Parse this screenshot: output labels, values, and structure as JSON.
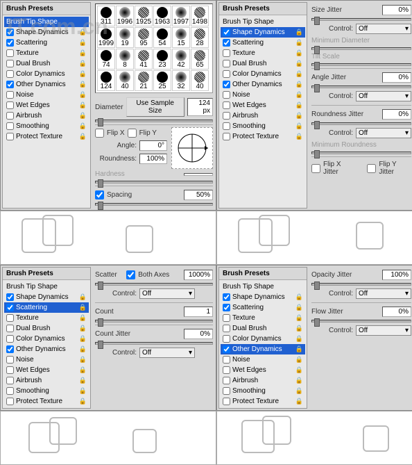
{
  "presets_header": "Brush Presets",
  "items": {
    "tip": "Brush Tip Shape",
    "shape": "Shape Dynamics",
    "scatter": "Scattering",
    "texture": "Texture",
    "dual": "Dual Brush",
    "color": "Color Dynamics",
    "other": "Other Dynamics",
    "noise": "Noise",
    "wet": "Wet Edges",
    "air": "Airbrush",
    "smooth": "Smoothing",
    "protect": "Protect Texture"
  },
  "brush_sizes": [
    "311",
    "1996",
    "1925",
    "1963",
    "1997",
    "1498",
    "1999",
    "19",
    "95",
    "54",
    "15",
    "28",
    "74",
    "8",
    "41",
    "23",
    "42",
    "65",
    "124",
    "40",
    "21",
    "25",
    "32",
    "40"
  ],
  "tip": {
    "diameter_lbl": "Diameter",
    "use_sample": "Use Sample Size",
    "diameter_val": "124 px",
    "flipx": "Flip X",
    "flipy": "Flip Y",
    "angle_lbl": "Angle:",
    "angle_val": "0°",
    "round_lbl": "Roundness:",
    "round_val": "100%",
    "hard_lbl": "Hardness",
    "spacing_lbl": "Spacing",
    "spacing_val": "50%"
  },
  "shape": {
    "size_jitter": "Size Jitter",
    "size_jitter_v": "0%",
    "control": "Control:",
    "off": "Off",
    "min_diam": "Minimum Diameter",
    "tilt": "Tilt Scale",
    "angle_jitter": "Angle Jitter",
    "angle_jitter_v": "0%",
    "round_jitter": "Roundness Jitter",
    "round_jitter_v": "0%",
    "min_round": "Minimum Roundness",
    "flipx_j": "Flip X Jitter",
    "flipy_j": "Flip Y Jitter"
  },
  "scatter": {
    "scatter_lbl": "Scatter",
    "both": "Both Axes",
    "scatter_v": "1000%",
    "count_lbl": "Count",
    "count_v": "1",
    "count_j": "Count Jitter",
    "count_j_v": "0%"
  },
  "other": {
    "opacity_j": "Opacity Jitter",
    "opacity_v": "100%",
    "flow_j": "Flow Jitter",
    "flow_v": "0%"
  },
  "watermark": "IT.com.cn"
}
